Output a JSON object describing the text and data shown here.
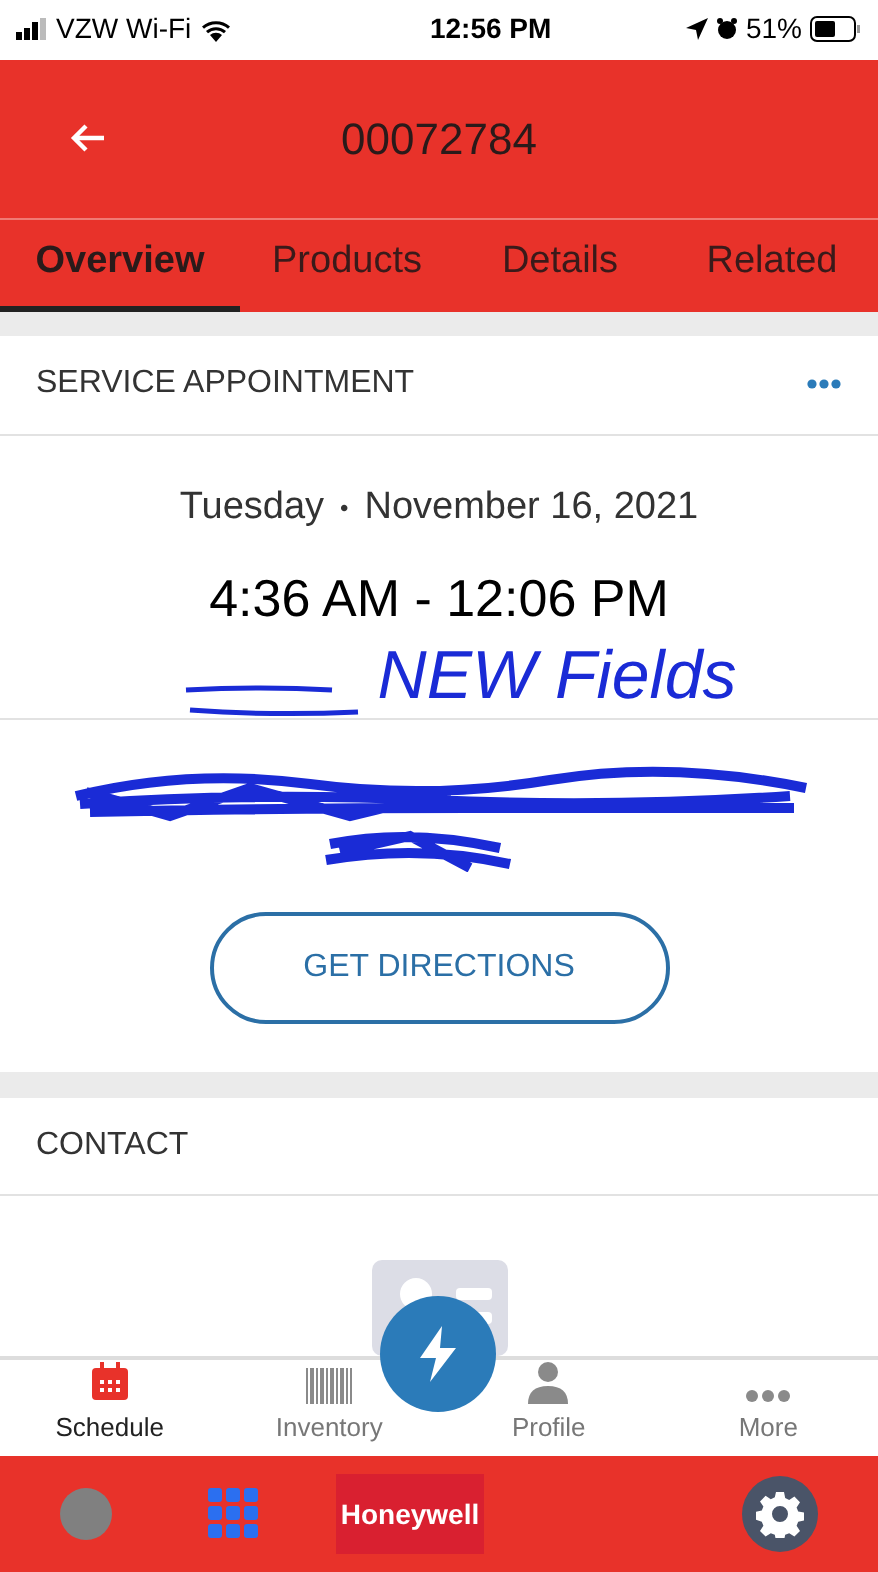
{
  "status_bar": {
    "carrier": "VZW Wi-Fi",
    "time": "12:56 PM",
    "battery": "51%"
  },
  "header": {
    "title": "00072784"
  },
  "tabs": [
    {
      "label": "Overview",
      "selected": true
    },
    {
      "label": "Products",
      "selected": false
    },
    {
      "label": "Details",
      "selected": false
    },
    {
      "label": "Related",
      "selected": false
    }
  ],
  "appointment": {
    "heading": "SERVICE APPOINTMENT",
    "day": "Tuesday",
    "separator": "•",
    "date": "November 16, 2021",
    "time_range": "4:36 AM - 12:06 PM",
    "button": "GET DIRECTIONS"
  },
  "annotation": {
    "text": "NEW Fields"
  },
  "contact": {
    "heading": "CONTACT"
  },
  "bottom_nav": [
    {
      "label": "Schedule",
      "kind": "calendar",
      "selected": true
    },
    {
      "label": "Inventory",
      "kind": "barcode",
      "selected": false
    },
    {
      "label": "Profile",
      "kind": "person",
      "selected": false
    },
    {
      "label": "More",
      "kind": "dots",
      "selected": false
    }
  ],
  "footer": {
    "logo": "Honeywell"
  }
}
